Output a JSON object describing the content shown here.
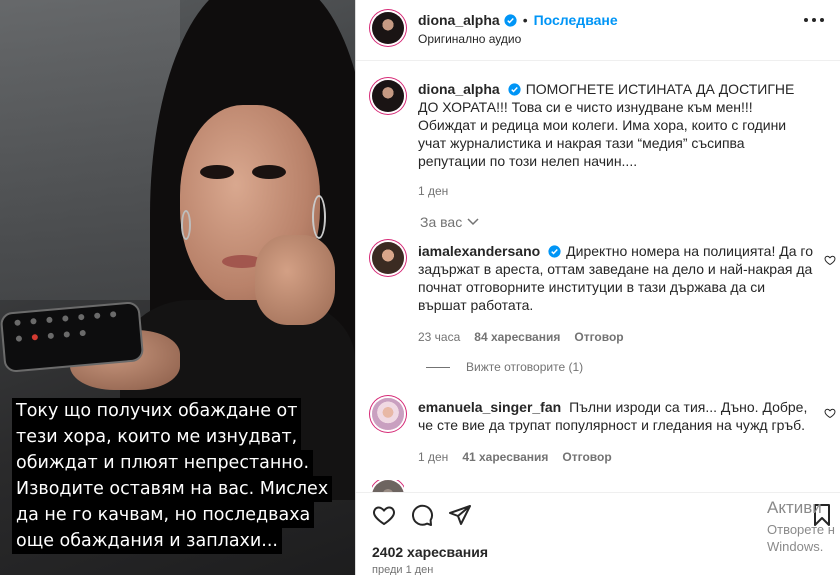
{
  "video": {
    "caption_lines": [
      "Току що получих обаждане от",
      "тези хора, които ме изнудват,",
      "обиждат и плюят непрестанно.",
      "Изводите оставям на вас. Мислех",
      "да не го качвам, но последваха",
      "още обаждания и заплахи..."
    ]
  },
  "post": {
    "username": "diona_alpha",
    "separator": "•",
    "follow_label": "Последване",
    "audio_label": "Оригинално аудио",
    "caption_username": "diona_alpha",
    "caption_text": "ПОМОГНЕТЕ ИСТИНАТА ДА ДОСТИГНЕ ДО ХОРАТА!!! Това си е чисто изнудване към мен!!! Обиждат и редица мои колеги. Има хора, които с години учат журналистика и накрая тази “медия” съсипва репутации по този нелеп начин....",
    "caption_time": "1 ден"
  },
  "for_you_label": "За вас",
  "comments": [
    {
      "username": "iamalexandersano",
      "text": "Директно номера на полицията! Да го задържат в ареста, оттам заведане на дело и най-накрая да почнат отговорните институции в тази държава да си вършат работата.",
      "time": "23 часа",
      "likes": "84 харесвания",
      "reply": "Отговор"
    },
    {
      "username": "emanuela_singer_fan",
      "text": "Пълни изроди са тия... Дъно. Добре, че сте вие да трупат популярност и гледания на чужд гръб.",
      "time": "1 ден",
      "likes": "41 харесвания",
      "reply": "Отговор"
    }
  ],
  "view_replies_label": "Вижте отговорите (1)",
  "likes_total": "2402 харесвания",
  "posted_ago": "преди 1 ден",
  "watermark": {
    "line1": "Активи",
    "line2": "Отворете н",
    "line3": "Windows."
  },
  "colors": {
    "accent": "#0095f6",
    "verified": "#0095f6",
    "secondary_text": "#737373"
  }
}
